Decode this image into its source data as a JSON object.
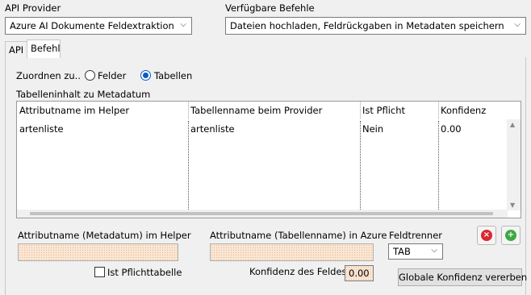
{
  "api_provider": {
    "label": "API Provider",
    "selected": "Azure AI Dokumente Feldextraktion"
  },
  "befehle": {
    "label": "Verfügbare Befehle",
    "selected": "Dateien hochladen, Feldrückgaben in Metadaten speichern"
  },
  "tabs": [
    {
      "label": "API"
    },
    {
      "label": "Befehl"
    }
  ],
  "zuordnen": {
    "label": "Zuordnen zu..",
    "options": [
      {
        "label": "Felder",
        "checked": false
      },
      {
        "label": "Tabellen",
        "checked": true
      }
    ]
  },
  "table_section_label": "Tabelleninhalt zu Metadatum",
  "grid": {
    "columns": [
      "Attributname im Helper",
      "Tabellenname beim Provider",
      "Ist Pflicht",
      "Konfidenz"
    ],
    "rows": [
      [
        "artenliste",
        "artenliste",
        "Nein",
        "0.00"
      ]
    ]
  },
  "form": {
    "helper_attr_label": "Attributname (Metadatum) im Helper",
    "azure_attr_label": "Attributname (Tabellenname) in Azure",
    "feldtrenner_label": "Feldtrenner",
    "feldtrenner_value": "TAB",
    "pflicht_label": "Ist Pflichttabelle",
    "pflicht_checked": false,
    "konfidenz_label": "Konfidenz des Feldes:",
    "konfidenz_value": "0.00",
    "global_button": "Globale Konfidenz vererben"
  },
  "colors": {
    "accent": "#0a5bc4",
    "remove": "#d9282f",
    "add": "#3fa845",
    "input_fill": "#fae6d4"
  }
}
